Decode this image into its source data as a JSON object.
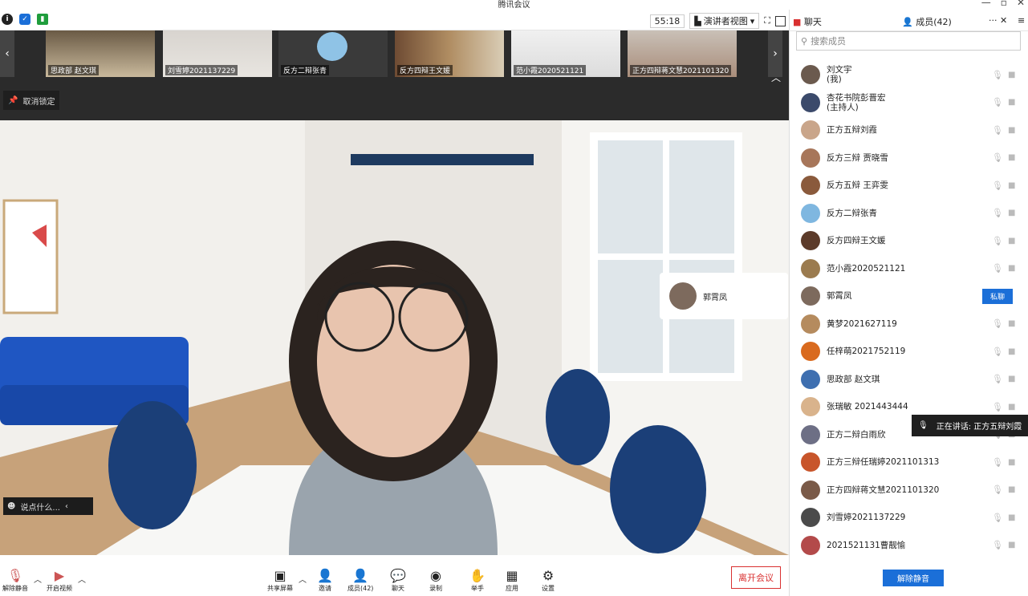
{
  "window": {
    "title": "腾讯会议",
    "min": "—",
    "max": "▫",
    "close": "✕"
  },
  "toolbar": {
    "timer": "55:18",
    "view_label": "演讲者视图",
    "view_caret": "▾"
  },
  "strip": {
    "tiles": [
      {
        "label": "思政部 赵文琪"
      },
      {
        "label": "刘雪婷2021137229"
      },
      {
        "label": "反方二辩张青"
      },
      {
        "label": "反方四辩王文媛"
      },
      {
        "label": "范小霞2020521121"
      },
      {
        "label": "正方四辩蒋文慧2021101320"
      }
    ],
    "prev": "‹",
    "next": "›",
    "unpin_label": "取消锁定"
  },
  "stage": {
    "floating_name": "郭霄凤",
    "chat_placeholder": "说点什么...",
    "chat_collapse": "‹"
  },
  "bottom": {
    "unmute": "解除静音",
    "video": "开启视频",
    "share": "共享屏幕",
    "invite": "邀请",
    "members": "成员(42)",
    "chat": "聊天",
    "record": "录制",
    "raise_hand": "举手",
    "apps": "应用",
    "settings": "设置",
    "leave": "离开会议"
  },
  "panel": {
    "tab_chat": "聊天",
    "tab_members": "成员(42)",
    "more": "···",
    "close": "✕",
    "menu": "≡",
    "search_placeholder": "搜索成员",
    "members": [
      {
        "name": "刘文宇",
        "sub": "(我)",
        "color": "#6b5a4e"
      },
      {
        "name": "杏花书院彭晋宏",
        "sub": "(主持人)",
        "color": "#3b4a6b"
      },
      {
        "name": "正方五辩刘霞",
        "sub": "",
        "color": "#c9a58a"
      },
      {
        "name": "反方三辩 贾晓雪",
        "sub": "",
        "color": "#a7765a"
      },
      {
        "name": "反方五辩 王弈雯",
        "sub": "",
        "color": "#8a5a3c"
      },
      {
        "name": "反方二辩张青",
        "sub": "",
        "color": "#7fb7e0"
      },
      {
        "name": "反方四辩王文媛",
        "sub": "",
        "color": "#5c3b2a"
      },
      {
        "name": "范小霞2020521121",
        "sub": "",
        "color": "#9b7b4f"
      },
      {
        "name": "郭霄凤",
        "sub": "",
        "color": "#7d6a5d"
      },
      {
        "name": "黄梦2021627119",
        "sub": "",
        "color": "#b58b5e"
      },
      {
        "name": "任梓萌2021752119",
        "sub": "",
        "color": "#d96a1e"
      },
      {
        "name": "思政部 赵文琪",
        "sub": "",
        "color": "#3e6fb0"
      },
      {
        "name": "张瑞敏 2021443444",
        "sub": "",
        "color": "#d9b38c"
      },
      {
        "name": "正方二辩白雨欣",
        "sub": "",
        "color": "#6d6f85"
      },
      {
        "name": "正方三辩任瑞婷2021101313",
        "sub": "",
        "color": "#c8552b"
      },
      {
        "name": "正方四辩蒋文慧2021101320",
        "sub": "",
        "color": "#7a5a48"
      },
      {
        "name": "刘雪婷2021137229",
        "sub": "",
        "color": "#4b4b4b"
      },
      {
        "name": "2021521131曹靓愉",
        "sub": "",
        "color": "#b34a4a"
      }
    ],
    "private_chat": "私聊",
    "unmute_all": "解除静音",
    "speaking": "正在讲话: 正方五辩刘霞"
  }
}
